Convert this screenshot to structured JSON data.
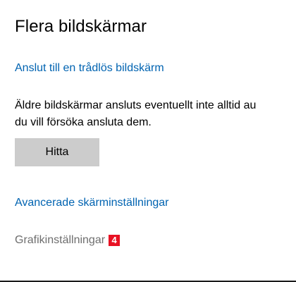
{
  "section": {
    "title": "Flera bildskärmar"
  },
  "links": {
    "wireless_display": "Anslut till en trådlös bildskärm",
    "advanced_display_settings": "Avancerade skärminställningar",
    "graphics_settings": "Grafikinställningar"
  },
  "description": {
    "line1": "Äldre bildskärmar ansluts eventuellt inte alltid au",
    "line2": "du vill försöka ansluta dem."
  },
  "buttons": {
    "detect_label": "Hitta"
  },
  "callout": {
    "number": "4",
    "color": "#e81123"
  },
  "colors": {
    "link": "#0063b1",
    "button_bg": "#cccccc",
    "muted_text": "#6e6e6e"
  }
}
